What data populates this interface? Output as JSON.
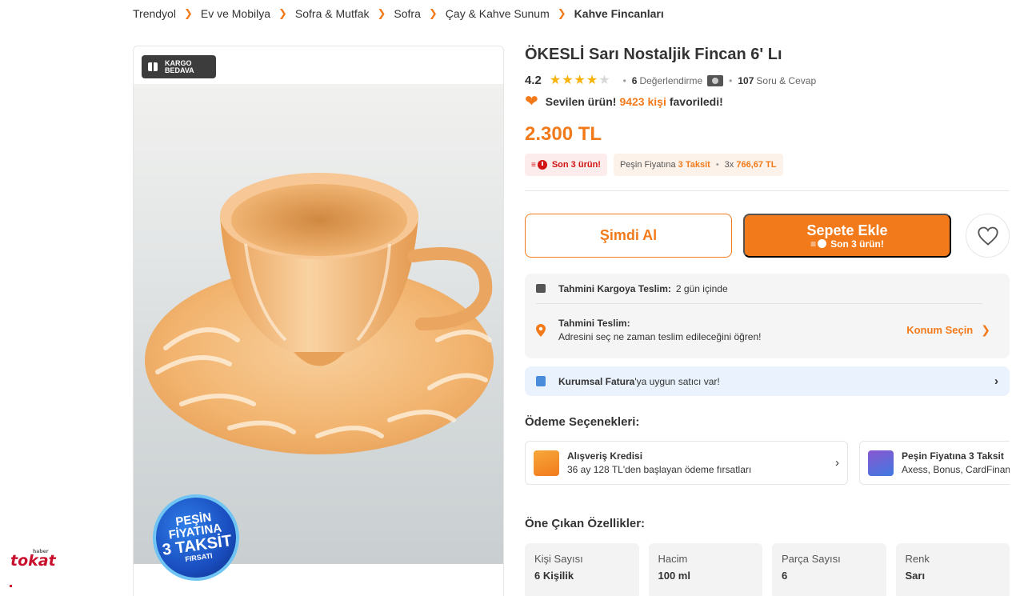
{
  "breadcrumb": {
    "items": [
      "Trendyol",
      "Ev ve Mobilya",
      "Sofra & Mutfak",
      "Sofra",
      "Çay & Kahve Sunum"
    ],
    "current": "Kahve Fincanları"
  },
  "gallery": {
    "kargo_badge": [
      "KARGO",
      "BEDAVA"
    ],
    "promo_badge": [
      "PEŞİN",
      "FİYATINA",
      "3 TAKSİT",
      "FIRSATI"
    ]
  },
  "watermark": {
    "brand": "tokat",
    "small": "haber"
  },
  "product": {
    "brand": "ÖKESLİ",
    "name": "Sarı Nostaljik Fincan 6' Lı",
    "rating": "4.2",
    "stars": 4,
    "review_count": "6",
    "review_label": "Değerlendirme",
    "qa_count": "107",
    "qa_label": "Soru & Cevap",
    "favorite": {
      "prefix": "Sevilen ürün!",
      "count": "9423 kişi",
      "suffix": "favoriledi!"
    },
    "price": "2.300 TL",
    "stock_tag": "Son 3 ürün!",
    "installment": {
      "label": "Peşin Fiyatına",
      "highlight": "3 Taksit",
      "monthly": "3x",
      "monthly_value": "766,67 TL"
    }
  },
  "actions": {
    "buy_now": "Şimdi Al",
    "add_to_cart": "Sepete Ekle",
    "add_to_cart_sub": "Son 3 ürün!"
  },
  "delivery": {
    "cargo_label": "Tahmini Kargoya Teslim:",
    "cargo_value": "2 gün içinde",
    "delivery_label": "Tahmini Teslim:",
    "delivery_desc": "Adresini seç ne zaman teslim edileceğini öğren!",
    "location_button": "Konum Seçin"
  },
  "invoice": {
    "bold": "Kurumsal Fatura",
    "rest": "'ya uygun satıcı var!"
  },
  "payment": {
    "title": "Ödeme Seçenekleri:",
    "cards": [
      {
        "title": "Alışveriş Kredisi",
        "desc": "36 ay 128 TL'den başlayan ödeme fırsatları"
      },
      {
        "title": "Peşin Fiyatına 3 Taksit",
        "desc": "Axess, Bonus, CardFinans"
      }
    ]
  },
  "features": {
    "title": "Öne Çıkan Özellikler:",
    "items": [
      {
        "label": "Kişi Sayısı",
        "value": "6 Kişilik"
      },
      {
        "label": "Hacim",
        "value": "100 ml"
      },
      {
        "label": "Parça Sayısı",
        "value": "6"
      },
      {
        "label": "Renk",
        "value": "Sarı"
      }
    ]
  },
  "colors": {
    "accent": "#f27a1a",
    "stock_red": "#d21313",
    "star": "#f9b208"
  }
}
